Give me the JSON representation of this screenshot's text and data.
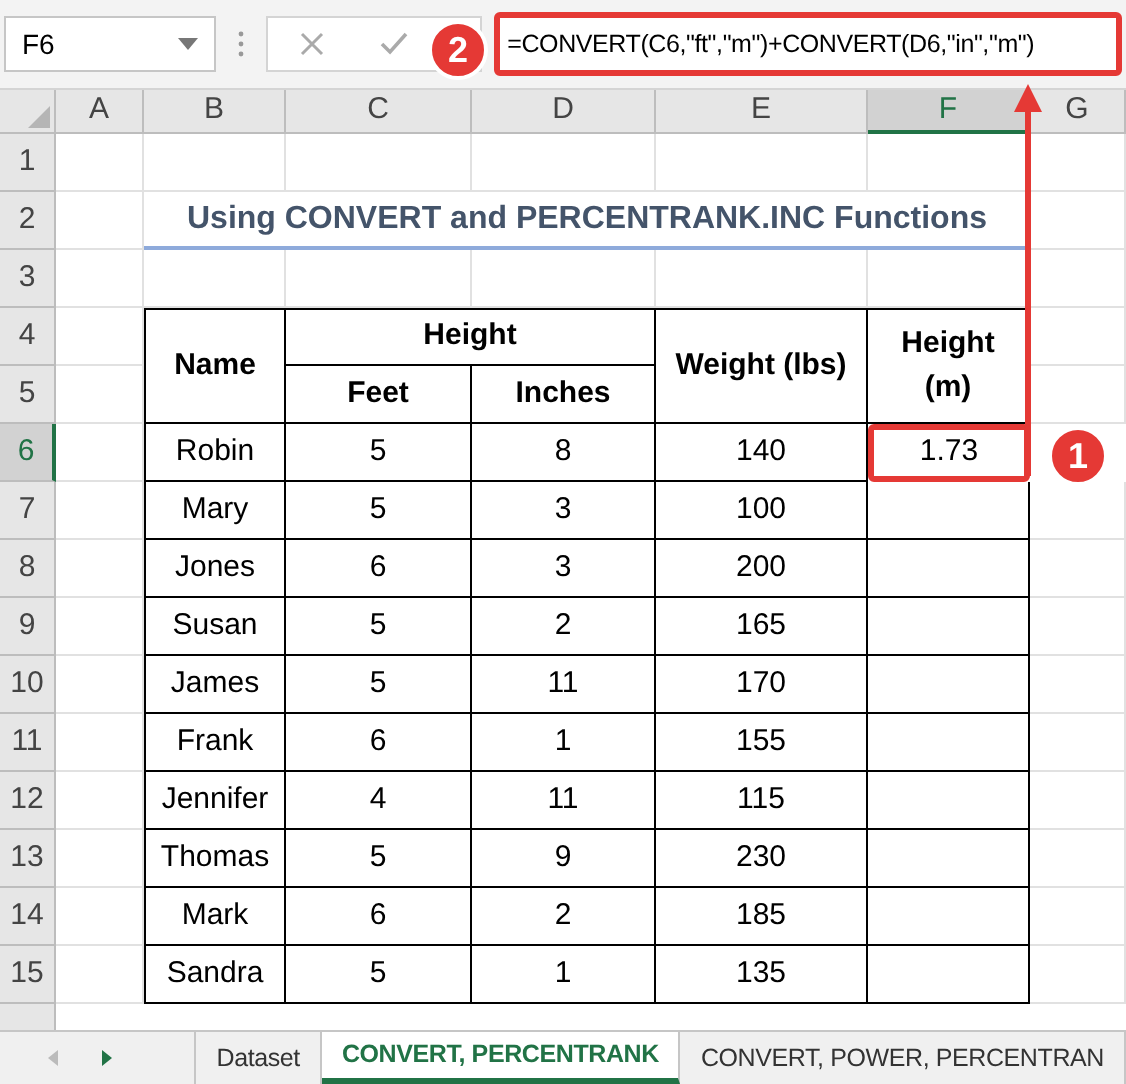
{
  "name_box": "F6",
  "formula": "=CONVERT(C6,\"ft\",\"m\")+CONVERT(D6,\"in\",\"m\")",
  "columns": [
    {
      "label": "A",
      "selected": false
    },
    {
      "label": "B",
      "selected": false
    },
    {
      "label": "C",
      "selected": false
    },
    {
      "label": "D",
      "selected": false
    },
    {
      "label": "E",
      "selected": false
    },
    {
      "label": "F",
      "selected": true
    },
    {
      "label": "G",
      "selected": false
    }
  ],
  "rows": [
    {
      "label": "1",
      "selected": false
    },
    {
      "label": "2",
      "selected": false
    },
    {
      "label": "3",
      "selected": false
    },
    {
      "label": "4",
      "selected": false
    },
    {
      "label": "5",
      "selected": false
    },
    {
      "label": "6",
      "selected": true
    },
    {
      "label": "7",
      "selected": false
    },
    {
      "label": "8",
      "selected": false
    },
    {
      "label": "9",
      "selected": false
    },
    {
      "label": "10",
      "selected": false
    },
    {
      "label": "11",
      "selected": false
    },
    {
      "label": "12",
      "selected": false
    },
    {
      "label": "13",
      "selected": false
    },
    {
      "label": "14",
      "selected": false
    },
    {
      "label": "15",
      "selected": false
    }
  ],
  "title": "Using CONVERT and PERCENTRANK.INC Functions",
  "table": {
    "headers": {
      "name": "Name",
      "height": "Height",
      "feet": "Feet",
      "inches": "Inches",
      "weight": "Weight (lbs)",
      "height_m": "Height (m)"
    },
    "rows": [
      {
        "name": "Robin",
        "feet": "5",
        "inches": "8",
        "weight": "140",
        "height_m": "1.73",
        "selected": true
      },
      {
        "name": "Mary",
        "feet": "5",
        "inches": "3",
        "weight": "100",
        "selected": false
      },
      {
        "name": "Jones",
        "feet": "6",
        "inches": "3",
        "weight": "200",
        "selected": false
      },
      {
        "name": "Susan",
        "feet": "5",
        "inches": "2",
        "weight": "165",
        "selected": false
      },
      {
        "name": "James",
        "feet": "5",
        "inches": "11",
        "weight": "170",
        "selected": false
      },
      {
        "name": "Frank",
        "feet": "6",
        "inches": "1",
        "weight": "155",
        "selected": false
      },
      {
        "name": "Jennifer",
        "feet": "4",
        "inches": "11",
        "weight": "115",
        "selected": false
      },
      {
        "name": "Thomas",
        "feet": "5",
        "inches": "9",
        "weight": "230",
        "selected": false
      },
      {
        "name": "Mark",
        "feet": "6",
        "inches": "2",
        "weight": "185",
        "selected": false
      },
      {
        "name": "Sandra",
        "feet": "5",
        "inches": "1",
        "weight": "135",
        "selected": false
      }
    ]
  },
  "callouts": [
    "1",
    "2"
  ],
  "sheet_tabs": [
    {
      "label": "Dataset",
      "selected": false
    },
    {
      "label": "CONVERT, PERCENTRANK",
      "selected": true
    },
    {
      "label": "CONVERT, POWER, PERCENTRAN",
      "selected": false
    }
  ]
}
